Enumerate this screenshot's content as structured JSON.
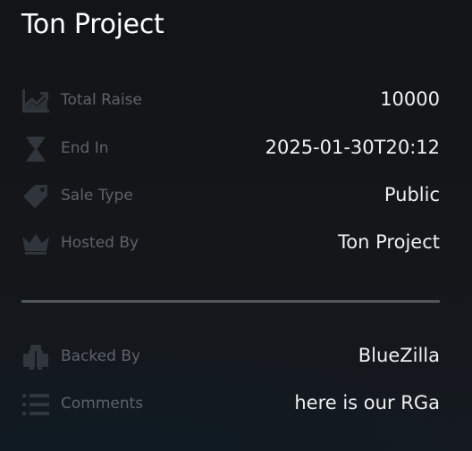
{
  "header": {
    "title": "Ton Project"
  },
  "details": [
    {
      "icon": "chart-trend-icon",
      "label": "Total Raise",
      "value": "10000"
    },
    {
      "icon": "hourglass-icon",
      "label": "End In",
      "value": "2025-01-30T20:12"
    },
    {
      "icon": "price-tag-icon",
      "label": "Sale Type",
      "value": "Public"
    },
    {
      "icon": "crown-icon",
      "label": "Hosted By",
      "value": "Ton Project"
    }
  ],
  "extra": [
    {
      "icon": "backers-icon",
      "label": "Backed By",
      "value": "BlueZilla"
    },
    {
      "icon": "list-icon",
      "label": "Comments",
      "value": "here is our RGa"
    }
  ],
  "colors": {
    "background": "#131518",
    "label": "#5d6368",
    "value": "#eef0f2",
    "icon": "#30363b",
    "divider": "#50565b"
  }
}
